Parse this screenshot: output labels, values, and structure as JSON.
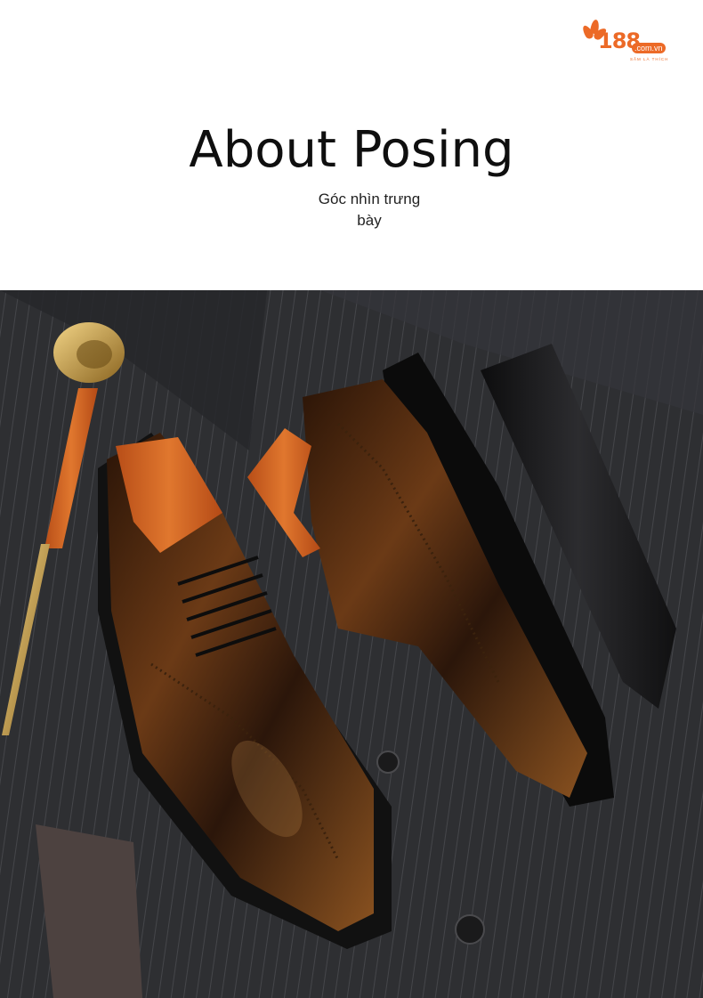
{
  "brand": {
    "logo_text": "188",
    "logo_domain": ".com.vn",
    "logo_tagline": "SẮM LÀ THÍCH",
    "accent_color": "#ec6a27"
  },
  "heading": {
    "title": "About Posing",
    "subtitle_line1": "Góc nhìn trưng",
    "subtitle_line2": "bày"
  },
  "photo": {
    "subject": "product-photo",
    "colors": {
      "suit": "#2f3033",
      "leather": "#5a2e12",
      "sole": "#0b0b0b",
      "wood": "#d9682a",
      "gold": "#c9a24a"
    }
  }
}
